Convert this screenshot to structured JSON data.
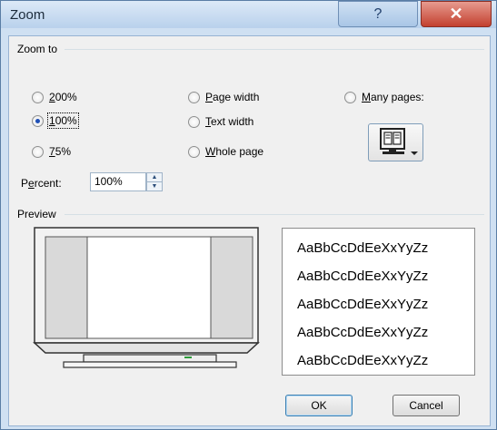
{
  "window": {
    "title": "Zoom",
    "help_label": "?",
    "close_label": "✕"
  },
  "zoom_to": {
    "group_label": "Zoom to",
    "options": [
      {
        "label": "200%",
        "mnemonic": "2",
        "checked": false
      },
      {
        "label": "100%",
        "mnemonic": "1",
        "checked": true
      },
      {
        "label": "75%",
        "mnemonic": "7",
        "checked": false
      },
      {
        "label": "Page width",
        "mnemonic": "P",
        "checked": false
      },
      {
        "label": "Text width",
        "mnemonic": "T",
        "checked": false
      },
      {
        "label": "Whole page",
        "mnemonic": "W",
        "checked": false
      },
      {
        "label": "Many pages:",
        "mnemonic": "M",
        "checked": false
      }
    ],
    "percent_label": "Percent:",
    "percent_value": "100%"
  },
  "preview": {
    "group_label": "Preview",
    "sample_lines": [
      "AaBbCcDdEeXxYyZz",
      "AaBbCcDdEeXxYyZz",
      "AaBbCcDdEeXxYyZz",
      "AaBbCcDdEeXxYyZz",
      "AaBbCcDdEeXxYyZz"
    ]
  },
  "buttons": {
    "ok": "OK",
    "cancel": "Cancel"
  },
  "icons": {
    "help": "help-icon",
    "close": "close-icon",
    "many_pages": "monitor-pages-icon"
  },
  "colors": {
    "title_bar": "#b9d1ec",
    "close_button": "#c3402f",
    "radio_selected": "#1f4fb5"
  }
}
